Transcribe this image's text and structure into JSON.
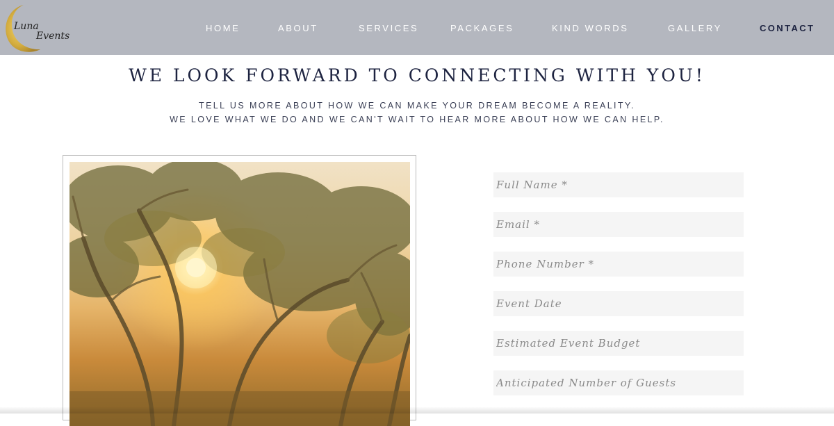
{
  "brand": {
    "logo_line1": "Luna",
    "logo_line2": "Events",
    "moon_color": "#d8b445"
  },
  "nav": {
    "items": [
      {
        "label": "HOME"
      },
      {
        "label": "ABOUT"
      },
      {
        "label": "SERVICES"
      },
      {
        "label": "PACKAGES"
      },
      {
        "label": "KIND WORDS"
      },
      {
        "label": "GALLERY"
      },
      {
        "label": "CONTACT",
        "active": true
      }
    ]
  },
  "hero": {
    "headline": "WE LOOK FORWARD TO CONNECTING WITH YOU!",
    "sub_line1": "TELL US MORE ABOUT HOW WE CAN MAKE YOUR DREAM BECOME A REALITY.",
    "sub_line2": "WE LOVE WHAT WE DO AND WE CAN'T WAIT TO HEAR MORE ABOUT HOW WE CAN HELP."
  },
  "photo": {
    "subject": "sunset-through-trees"
  },
  "form": {
    "fields": [
      {
        "placeholder": "Full Name *",
        "value": ""
      },
      {
        "placeholder": "Email *",
        "value": ""
      },
      {
        "placeholder": "Phone Number *",
        "value": ""
      },
      {
        "placeholder": "Event Date",
        "value": ""
      },
      {
        "placeholder": "Estimated Event Budget",
        "value": ""
      },
      {
        "placeholder": "Anticipated Number of Guests",
        "value": ""
      }
    ]
  },
  "colors": {
    "header_bg": "#b4b7bf",
    "nav_text": "#ffffff",
    "nav_active": "#1d2340",
    "headline": "#1d2340",
    "field_bg": "#f5f5f5"
  }
}
